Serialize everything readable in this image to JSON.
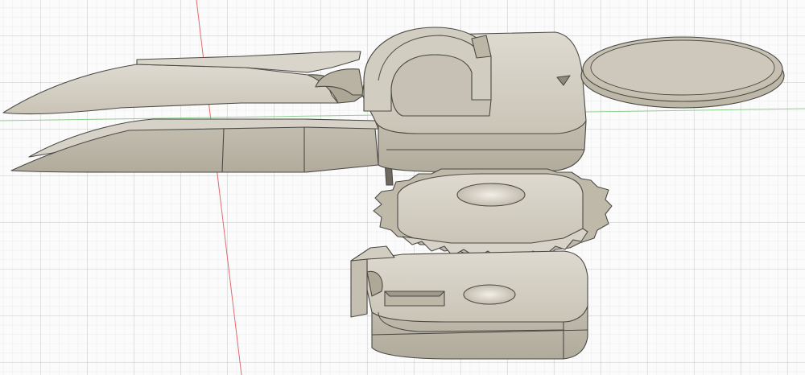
{
  "viewport": {
    "background": "#fbfbfb",
    "grid_color": "#c9c9c9",
    "axis_x_color": "#e36b6b",
    "axis_y_color": "#7fc87f"
  },
  "model": {
    "face_color": "#cfcabd",
    "face_light": "#e6e2d8",
    "face_dark": "#aaa597",
    "edge_color": "#4c4a45",
    "parts": [
      "tweezer-arm-upper",
      "tweezer-arm-lower",
      "ring-holder-top-plate",
      "coin-disc",
      "gear-wheel",
      "base-bracket"
    ]
  }
}
